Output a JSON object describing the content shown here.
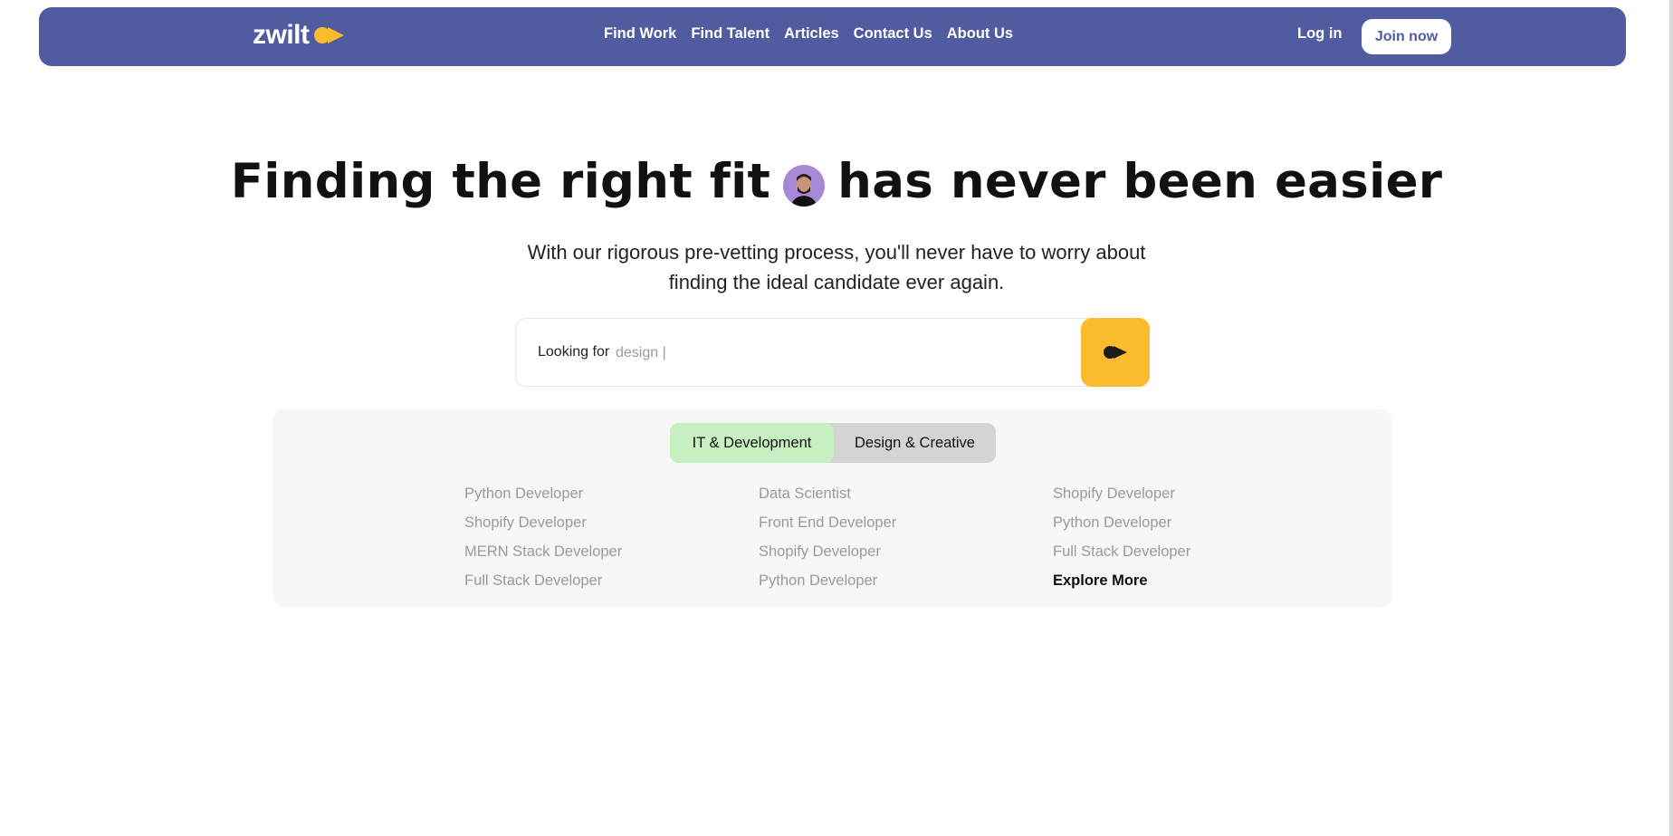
{
  "brand": {
    "name": "zwilt",
    "accent": "#fbbb2e",
    "nav_bg": "#515ca0"
  },
  "nav": {
    "links": [
      "Find Work",
      "Find Talent",
      "Articles",
      "Contact Us",
      "About Us"
    ],
    "login": "Log in",
    "join": "Join now"
  },
  "hero": {
    "title_part1": "Finding the right fit",
    "title_part2": "has never been easier",
    "subtitle_line1": "With our rigorous pre-vetting process, you'll never have to worry about",
    "subtitle_line2": "finding the ideal candidate ever again."
  },
  "search": {
    "prefix": "Looking for",
    "value": "design |",
    "button_icon": "arrow-right-icon"
  },
  "categories": {
    "tabs": [
      {
        "label": "IT & Development",
        "active": true
      },
      {
        "label": "Design & Creative",
        "active": false
      }
    ],
    "columns": [
      [
        "Python Developer",
        "Shopify Developer",
        "MERN Stack Developer",
        "Full Stack Developer"
      ],
      [
        "Data Scientist",
        "Front End Developer",
        "Shopify Developer",
        "Python Developer"
      ],
      [
        "Shopify Developer",
        "Python Developer",
        "Full Stack Developer",
        "Explore More"
      ]
    ]
  }
}
